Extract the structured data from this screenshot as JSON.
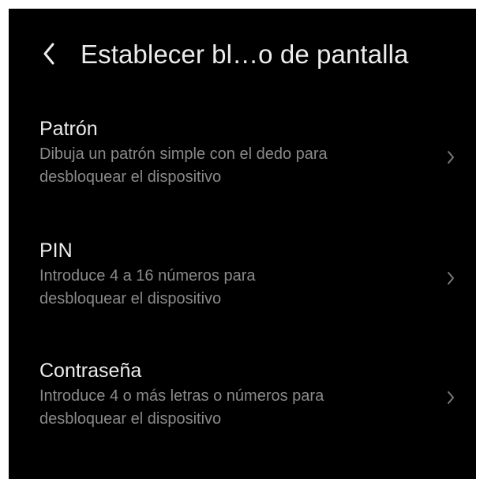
{
  "header": {
    "title": "Establecer bl…o de pantalla",
    "back_icon": "chevron-left-icon"
  },
  "options": [
    {
      "title": "Patrón",
      "desc_line1": "Dibuja un patrón simple con el dedo para",
      "desc_line2": "desbloquear el dispositivo",
      "icon": "chevron-right-icon"
    },
    {
      "title": "PIN",
      "desc_line1": "Introduce 4 a 16 números para",
      "desc_line2": "desbloquear el dispositivo",
      "icon": "chevron-right-icon"
    },
    {
      "title": "Contraseña",
      "desc_line1": "Introduce 4 o más letras o números para",
      "desc_line2": "desbloquear el dispositivo",
      "icon": "chevron-right-icon"
    }
  ],
  "colors": {
    "background": "#000000",
    "title_text": "#ececec",
    "secondary_text": "#8a8a8a",
    "chevron": "#7a7a7a"
  }
}
